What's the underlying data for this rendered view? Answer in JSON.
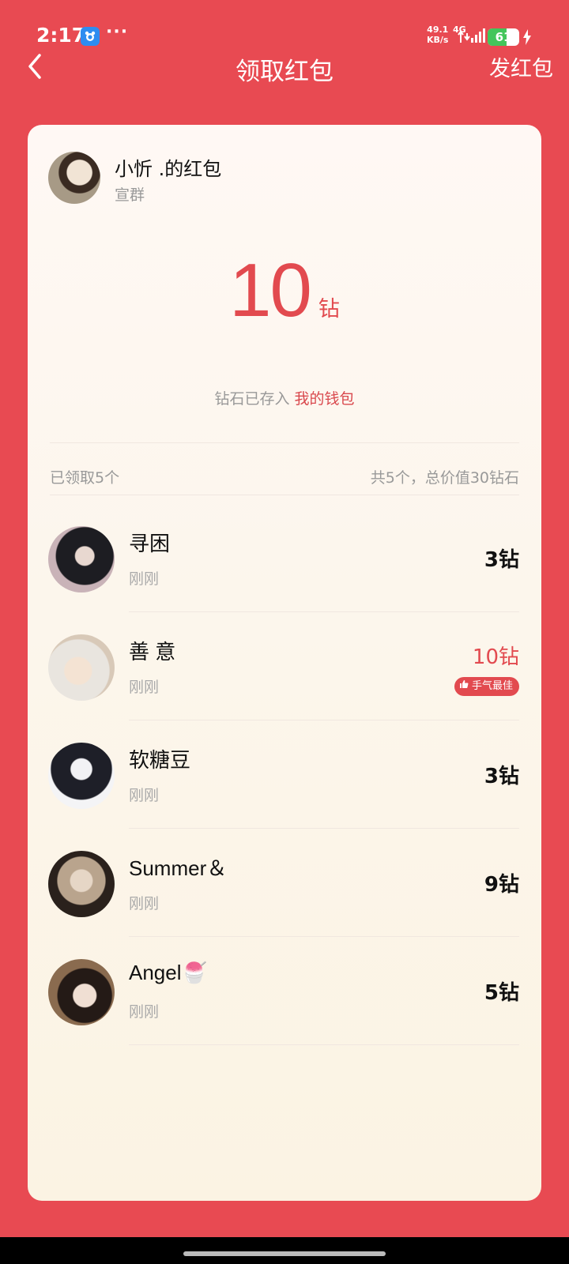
{
  "status_bar": {
    "time": "2:17",
    "dots": "···",
    "net_speed_value": "49.1",
    "net_speed_unit": "KB/s",
    "net_type": "4G",
    "battery": "61",
    "battery_level": 0.61
  },
  "nav": {
    "title": "领取红包",
    "right_action": "发红包"
  },
  "sender": {
    "name": "小忻 .的红包",
    "group": "宣群"
  },
  "amount": {
    "value": "10",
    "unit": "钻"
  },
  "wallet": {
    "prefix": "钻石已存入",
    "link": "我的钱包"
  },
  "summary": {
    "claimed": "已领取5个",
    "total": "共5个，总价值30钻石"
  },
  "records": [
    {
      "name": "寻困",
      "time": "刚刚",
      "amount": "3钻"
    },
    {
      "name": "善 意",
      "time": "刚刚",
      "amount": "10钻",
      "badge": "手气最佳"
    },
    {
      "name": "软糖豆",
      "time": "刚刚",
      "amount": "3钻"
    },
    {
      "name": "Summer＆",
      "time": "刚刚",
      "amount": "9钻"
    },
    {
      "name": "Angel🍧",
      "time": "刚刚",
      "amount": "5钻"
    }
  ],
  "colors": {
    "background": "#E84A52",
    "accent": "#E24A4F"
  }
}
